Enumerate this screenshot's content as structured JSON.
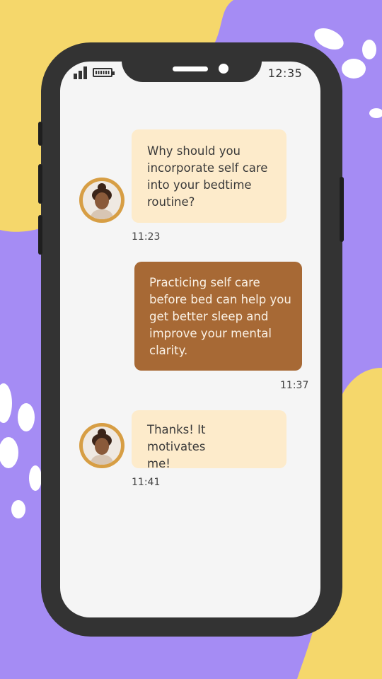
{
  "status_bar": {
    "time": "12:35",
    "signal_icon": "signal-bars-icon",
    "battery_icon": "battery-icon"
  },
  "colors": {
    "background": "#A58CF4",
    "blob_yellow": "#F5D76B",
    "incoming_bubble": "#FDEBCB",
    "outgoing_bubble": "#A76935",
    "avatar_ring": "#D79E44"
  },
  "messages": [
    {
      "sender": "incoming",
      "text": "Why should you incorporate self care into your bedtime routine?",
      "time": "11:23",
      "avatar_icon": "woman-avatar-icon"
    },
    {
      "sender": "outgoing",
      "text": "Practicing self care before bed can help you get better sleep and improve your mental clarity.",
      "time": "11:37"
    },
    {
      "sender": "incoming",
      "text": "Thanks! It motivates me!",
      "time": "11:41",
      "avatar_icon": "woman-avatar-icon"
    }
  ]
}
